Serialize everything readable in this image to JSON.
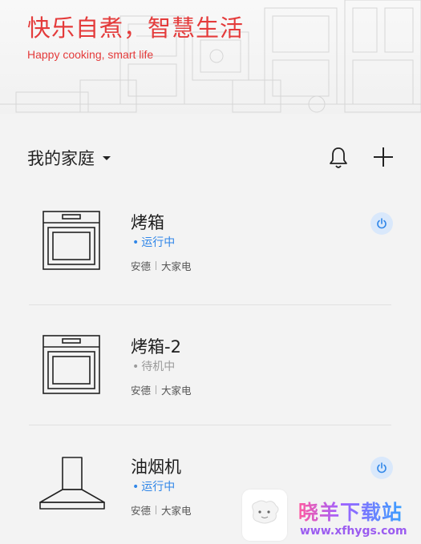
{
  "hero": {
    "title": "快乐自煮，智慧生活",
    "subtitle": "Happy cooking, smart life"
  },
  "header": {
    "home_label": "我的家庭",
    "caret_icon": "caret-down-icon",
    "bell_icon": "bell-icon",
    "add_icon": "plus-icon"
  },
  "devices": [
    {
      "name": "烤箱",
      "status": "运行中",
      "status_state": "running",
      "brand": "安德",
      "category": "大家电",
      "icon": "oven-icon",
      "power": true
    },
    {
      "name": "烤箱-2",
      "status": "待机中",
      "status_state": "idle",
      "brand": "安德",
      "category": "大家电",
      "icon": "oven-icon",
      "power": false
    },
    {
      "name": "油烟机",
      "status": "运行中",
      "status_state": "running",
      "brand": "安德",
      "category": "大家电",
      "icon": "range-hood-icon",
      "power": true
    }
  ],
  "colors": {
    "accent_red": "#e43b3b",
    "running_blue": "#2f86e8",
    "idle_gray": "#9a9a9a",
    "power_bg": "#d9e8fb"
  },
  "watermark": {
    "site_name": "晓羊下载站",
    "url": "www.xfhygs.com"
  }
}
